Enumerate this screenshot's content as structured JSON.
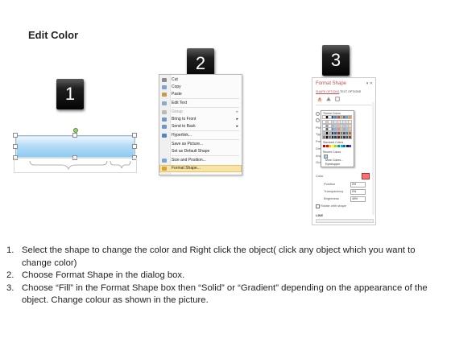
{
  "title": "Edit Color",
  "step_badges": [
    "1",
    "2",
    "3"
  ],
  "context_menu": {
    "items": [
      {
        "label": "Cut",
        "icon": "scissors-icon",
        "color": "#8a8a8a"
      },
      {
        "label": "Copy",
        "icon": "copy-icon",
        "color": "#7aa3d6"
      },
      {
        "label": "Paste",
        "icon": "paste-icon",
        "color": "#c79a4a"
      },
      {
        "label": "Edit Text",
        "icon": "edit-text-icon",
        "color": "#8aaac8"
      },
      {
        "label": "Group",
        "icon": "group-icon",
        "color": "#b8b8b8",
        "disabled": true,
        "submenu": true
      },
      {
        "label": "Bring to Front",
        "icon": "bring-front-icon",
        "color": "#6f96c6",
        "submenu": true
      },
      {
        "label": "Send to Back",
        "icon": "send-back-icon",
        "color": "#6f96c6",
        "submenu": true
      },
      {
        "label": "Hyperlink...",
        "icon": "hyperlink-icon",
        "color": "#4f86c6"
      },
      {
        "label": "Save as Picture...",
        "icon": "",
        "color": ""
      },
      {
        "label": "Set as Default Shape",
        "icon": "",
        "color": ""
      },
      {
        "label": "Size and Position...",
        "icon": "size-position-icon",
        "color": "#7aa3d6"
      },
      {
        "label": "Format Shape...",
        "icon": "format-shape-icon",
        "color": "#d8a13a",
        "highlighted": true
      }
    ]
  },
  "format_pane": {
    "title": "Format Shape",
    "close_glyph": "▾ ✕",
    "tabs": [
      "SHAPE OPTIONS",
      "TEXT OPTIONS"
    ],
    "row_labels": [
      "Fill",
      "Gradient",
      "Picture",
      "Type",
      "Preset",
      "Direction",
      "Angle",
      "Gradient"
    ],
    "palette": {
      "theme_header": "Theme Colors",
      "standard_header": "Standard Colors",
      "recent_header": "Recent Colors",
      "more_colors": "More Colors...",
      "eyedropper": "Eyedropper",
      "theme_colors": [
        "#ffffff",
        "#000000",
        "#eeece1",
        "#1f497d",
        "#4f81bd",
        "#c0504d",
        "#9bbb59",
        "#8064a2",
        "#4bacc6",
        "#f79646"
      ],
      "standard_colors": [
        "#c00000",
        "#ff0000",
        "#ffc000",
        "#ffff00",
        "#92d050",
        "#00b050",
        "#00b0f0",
        "#0070c0",
        "#002060",
        "#7030a0"
      ]
    },
    "color_label": "Color",
    "position_label": "Position",
    "position_value": "0%",
    "transparency_label": "Transparency",
    "transparency_value": "0%",
    "brightness_label": "Brightness",
    "brightness_value": "40%",
    "rotate_label": "Rotate with shape",
    "line_label": "LINE"
  },
  "steps": [
    {
      "num": "1.",
      "text": "Select the shape to change the color and Right click the object( click any object which you want to change color)"
    },
    {
      "num": "2.",
      "text": "Choose Format Shape in the dialog box."
    },
    {
      "num": "3.",
      "text": "Choose “Fill” in the Format Shape box then “Solid” or “Gradient” depending on the appearance of the object. Change colour as shown in the picture."
    }
  ]
}
